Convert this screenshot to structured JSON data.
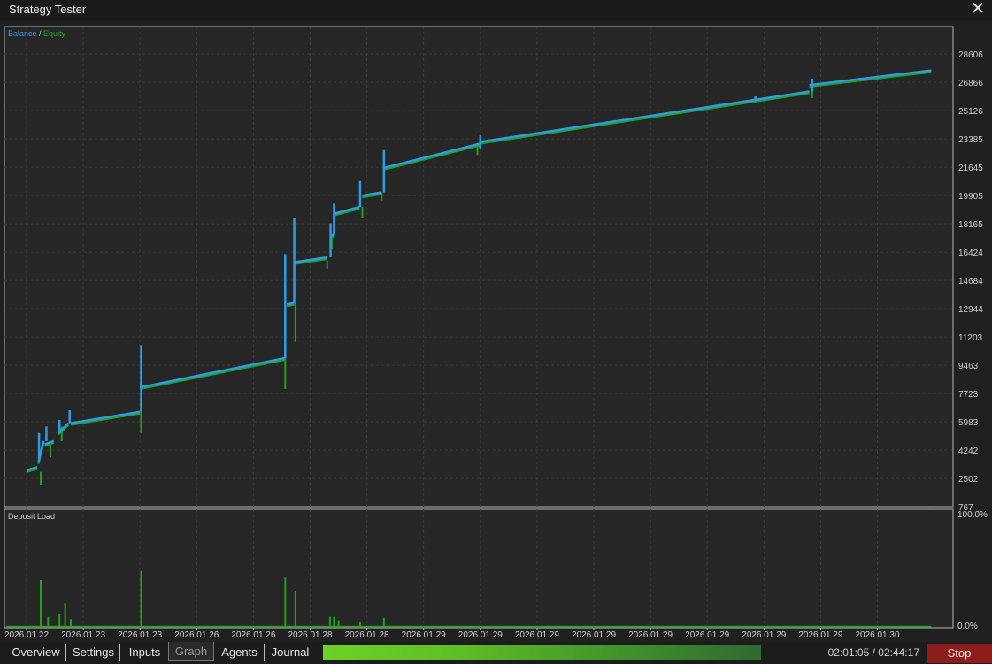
{
  "window": {
    "title": "Strategy Tester",
    "close_icon": "close-icon"
  },
  "tabs": [
    {
      "label": "Overview",
      "active": false
    },
    {
      "label": "Settings",
      "active": false
    },
    {
      "label": "Inputs",
      "active": false
    },
    {
      "label": "Graph",
      "active": true
    },
    {
      "label": "Agents",
      "active": false
    },
    {
      "label": "Journal",
      "active": false
    }
  ],
  "status": {
    "time": "02:01:05 / 02:44:17",
    "progress_fraction": 0.74,
    "stop_label": "Stop",
    "stop_color": "#8b1d1d"
  },
  "chart_data": [
    {
      "type": "line",
      "legend": {
        "balance_label": "Balance",
        "separator": " / ",
        "equity_label": "Equity",
        "placement": "top-left"
      },
      "colors": {
        "balance": "#2e9be6",
        "equity": "#1fa31f"
      },
      "y_ticks": [
        767,
        2502,
        4242,
        5983,
        7723,
        9463,
        11203,
        12944,
        14684,
        16424,
        18165,
        19905,
        21645,
        23385,
        25126,
        26866,
        28606
      ],
      "ylim": [
        767,
        30300
      ],
      "grid": true,
      "segments": [
        {
          "x0": 0.0,
          "x1": 0.19,
          "y0": 3000,
          "y1": 3200
        },
        {
          "x0": 0.21,
          "x1": 0.3,
          "y0": 3500,
          "y1": 4800
        },
        {
          "x0": 0.32,
          "x1": 0.48,
          "y0": 4600,
          "y1": 4800
        },
        {
          "x0": 0.56,
          "x1": 0.74,
          "y0": 5300,
          "y1": 5900
        },
        {
          "x0": 0.78,
          "x1": 2.0,
          "y0": 5900,
          "y1": 6600
        },
        {
          "x0": 2.0,
          "x1": 4.55,
          "y0": 8100,
          "y1": 9900
        },
        {
          "x0": 4.59,
          "x1": 4.72,
          "y0": 13200,
          "y1": 13300
        },
        {
          "x0": 4.72,
          "x1": 5.3,
          "y0": 15800,
          "y1": 16100
        },
        {
          "x0": 5.35,
          "x1": 5.42,
          "y0": 17400,
          "y1": 17500
        },
        {
          "x0": 5.44,
          "x1": 5.87,
          "y0": 18800,
          "y1": 19200
        },
        {
          "x0": 5.92,
          "x1": 6.26,
          "y0": 19900,
          "y1": 20100
        },
        {
          "x0": 6.3,
          "x1": 8.0,
          "y0": 21600,
          "y1": 23100
        },
        {
          "x0": 8.0,
          "x1": 13.8,
          "y0": 23200,
          "y1": 26300
        },
        {
          "x0": 13.8,
          "x1": 15.95,
          "y0": 26700,
          "y1": 27600
        }
      ],
      "balance_spikes": [
        {
          "x": 0.22,
          "from": 3500,
          "to": 5300
        },
        {
          "x": 0.35,
          "from": 4800,
          "to": 5700
        },
        {
          "x": 0.58,
          "from": 5300,
          "to": 6100
        },
        {
          "x": 0.76,
          "from": 5900,
          "to": 6700
        },
        {
          "x": 2.02,
          "from": 6600,
          "to": 10700
        },
        {
          "x": 4.56,
          "from": 9900,
          "to": 16300
        },
        {
          "x": 4.72,
          "from": 13300,
          "to": 18500
        },
        {
          "x": 5.36,
          "from": 16100,
          "to": 18200
        },
        {
          "x": 5.42,
          "from": 17500,
          "to": 19400
        },
        {
          "x": 5.88,
          "from": 19200,
          "to": 20800
        },
        {
          "x": 6.3,
          "from": 20100,
          "to": 22700
        },
        {
          "x": 8.0,
          "from": 22800,
          "to": 23600
        },
        {
          "x": 12.85,
          "from": 25800,
          "to": 26000
        },
        {
          "x": 13.85,
          "from": 26300,
          "to": 27100
        }
      ],
      "equity_spikes": [
        {
          "x": 0.25,
          "from": 2900,
          "to": 2100
        },
        {
          "x": 0.42,
          "from": 4700,
          "to": 3800
        },
        {
          "x": 0.62,
          "from": 5700,
          "to": 4800
        },
        {
          "x": 2.02,
          "from": 6600,
          "to": 5300
        },
        {
          "x": 4.56,
          "from": 9900,
          "to": 8000
        },
        {
          "x": 4.74,
          "from": 13300,
          "to": 10900
        },
        {
          "x": 5.3,
          "from": 15900,
          "to": 15400
        },
        {
          "x": 5.38,
          "from": 17400,
          "to": 16600
        },
        {
          "x": 5.92,
          "from": 19200,
          "to": 18500
        },
        {
          "x": 6.26,
          "from": 20100,
          "to": 19600
        },
        {
          "x": 7.95,
          "from": 23100,
          "to": 22400
        },
        {
          "x": 13.85,
          "from": 26300,
          "to": 25900
        }
      ]
    },
    {
      "type": "bar",
      "title": "Deposit Load",
      "y_ticks": [
        "100.0%",
        "0.0%"
      ],
      "ylim": [
        0,
        100
      ],
      "color": "#1fa31f",
      "bars": [
        {
          "x": 0.25,
          "value": 40
        },
        {
          "x": 0.38,
          "value": 8
        },
        {
          "x": 0.58,
          "value": 10
        },
        {
          "x": 0.68,
          "value": 20
        },
        {
          "x": 0.78,
          "value": 6
        },
        {
          "x": 2.02,
          "value": 48
        },
        {
          "x": 4.56,
          "value": 42
        },
        {
          "x": 4.74,
          "value": 30
        },
        {
          "x": 5.35,
          "value": 8
        },
        {
          "x": 5.42,
          "value": 8
        },
        {
          "x": 5.5,
          "value": 5
        },
        {
          "x": 5.88,
          "value": 4
        },
        {
          "x": 6.3,
          "value": 7
        }
      ],
      "x_ticks": [
        "2026.01.22",
        "2026.01.23",
        "2026.01.23",
        "2026.01.26",
        "2026.01.26",
        "2026.01.28",
        "2026.01.28",
        "2026.01.29",
        "2026.01.29",
        "2026.01.29",
        "2026.01.29",
        "2026.01.29",
        "2026.01.29",
        "2026.01.29",
        "2026.01.29",
        "2026.01.30"
      ]
    }
  ]
}
